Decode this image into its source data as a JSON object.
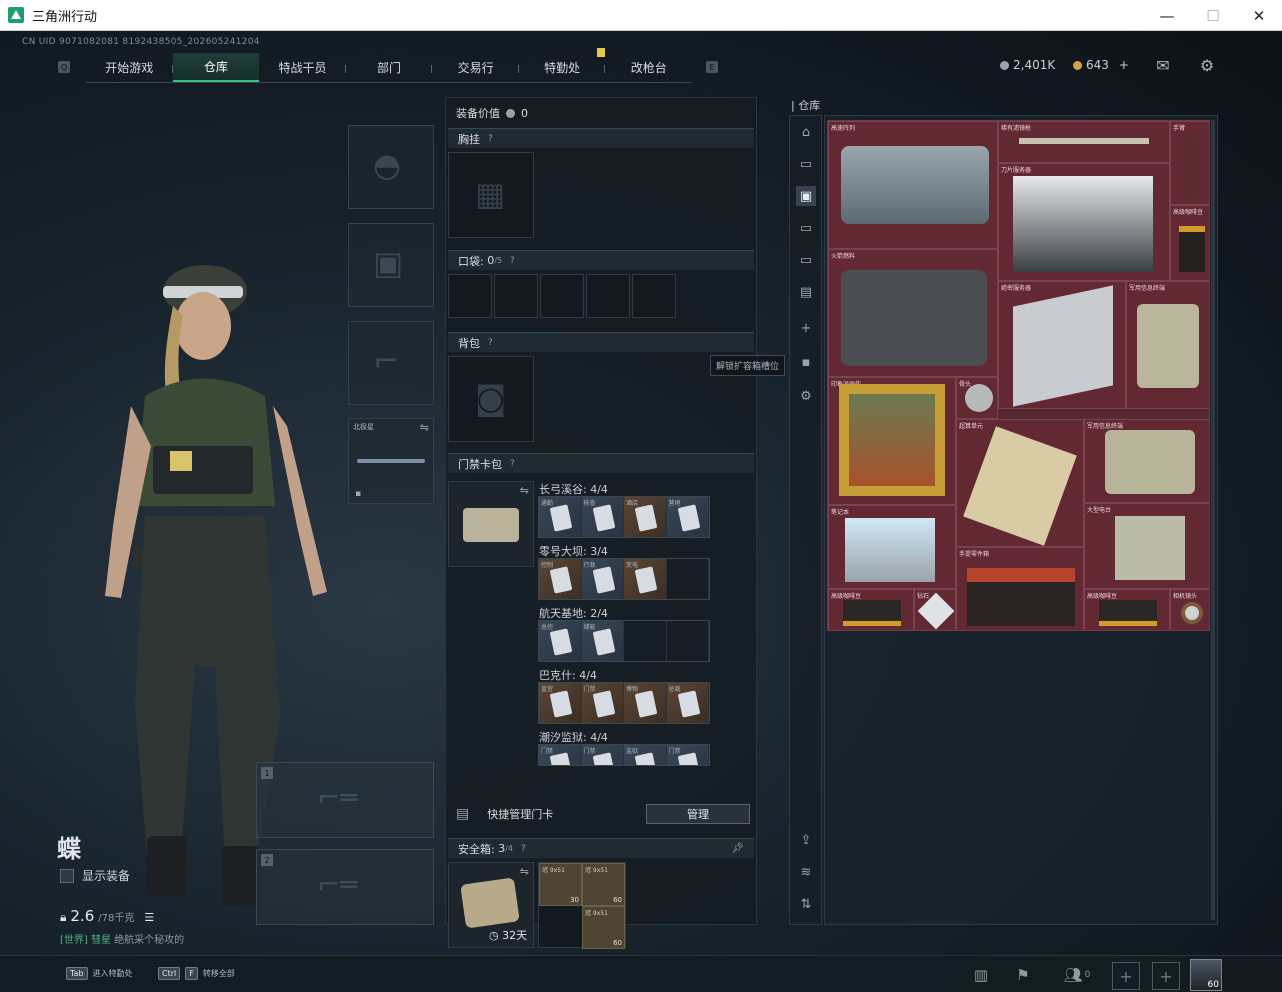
{
  "window": {
    "title": "三角洲行动",
    "min": "—",
    "max": "☐",
    "close": "✕"
  },
  "uid": "CN UID 9071082081 8192438505_202605241204",
  "nav": {
    "left_key": "Q",
    "right_key": "E",
    "tabs": [
      "开始游戏",
      "仓库",
      "特战干员",
      "部门",
      "交易行",
      "特勤处",
      "改枪台"
    ],
    "active": "仓库"
  },
  "currency": {
    "havoc": "2,401K",
    "coupon": "643",
    "add": "+"
  },
  "character": {
    "name": "蝶",
    "show_gear_label": "显示装备",
    "weight_value": "2.6",
    "weight_unit": "/78千克",
    "chat_channel": "[世界]",
    "chat_user": "彗星",
    "chat_text": "绝航采个秘攻的"
  },
  "equipment": {
    "melee_label": "北极星",
    "weapon_slot_1": "1",
    "weapon_slot_2": "2"
  },
  "middle": {
    "equip_value_label": "装备价值",
    "equip_value": "0",
    "chest_rig": "胸挂",
    "pockets_label": "口袋:",
    "pockets_count": "0",
    "pockets_max": "/5",
    "backpack": "背包",
    "keycard_pack": "门禁卡包",
    "unlock_hint": "解锁扩容箱槽位",
    "maps": [
      {
        "name": "长弓溪谷: 4/4",
        "cards": [
          "通勤",
          "核查",
          "酒店",
          "营地"
        ]
      },
      {
        "name": "零号大坝: 3/4",
        "cards": [
          "控制",
          "行政",
          "变电"
        ]
      },
      {
        "name": "航天基地: 2/4",
        "cards": [
          "总控",
          "储能"
        ]
      },
      {
        "name": "巴克什: 4/4",
        "cards": [
          "皇宫",
          "门禁",
          "博物",
          "总裁"
        ]
      },
      {
        "name": "潮汐监狱: 4/4",
        "cards": [
          "门禁",
          "门禁",
          "监狱",
          "门禁"
        ]
      }
    ],
    "quick_manage": "快捷管理门卡",
    "manage_btn": "管理",
    "safe_box_label": "安全箱:",
    "safe_box_count": "3",
    "safe_box_max": "/4",
    "safe_box_days": "32天",
    "ammo": [
      {
        "name": "冠 9x51",
        "count": "30"
      },
      {
        "name": "冠 9x51",
        "count": "60"
      },
      {
        "name": "冠 9x51",
        "count": "60"
      }
    ]
  },
  "storage": {
    "title": "仓库",
    "items": [
      {
        "label": "高速阵列",
        "icon": "server-array"
      },
      {
        "label": "稀有滤镜枪",
        "icon": "rifle"
      },
      {
        "label": "手臂",
        "icon": "arm"
      },
      {
        "label": "刀片服务器",
        "icon": "blade-server"
      },
      {
        "label": "高级咖啡豆",
        "icon": "coffee"
      },
      {
        "label": "火箭燃料",
        "icon": "fuel-can"
      },
      {
        "label": "绝密服务器",
        "icon": "motherboard"
      },
      {
        "label": "军用信息终端",
        "icon": "terminal"
      },
      {
        "label": "印象派画作",
        "icon": "painting"
      },
      {
        "label": "骨头",
        "icon": "medal"
      },
      {
        "label": "超算单元",
        "icon": "cpu-unit"
      },
      {
        "label": "军用信息终端",
        "icon": "terminal"
      },
      {
        "label": "笔记本",
        "icon": "laptop"
      },
      {
        "label": "大型电台",
        "icon": "radio"
      },
      {
        "label": "手提零件箱",
        "icon": "parts-box"
      },
      {
        "label": "高级咖啡豆",
        "icon": "coffee"
      },
      {
        "label": "钻石",
        "icon": "diamond"
      },
      {
        "label": "高级咖啡豆",
        "icon": "coffee"
      },
      {
        "label": "相机镜头",
        "icon": "lens"
      }
    ]
  },
  "bottom": {
    "tab_key": "Tab",
    "tab_hint": "进入特勤处",
    "ctrl_key": "Ctrl",
    "f_key": "F",
    "ctrl_hint": "转移全部",
    "friends_count": "0",
    "level": "60"
  },
  "colors": {
    "accent": "#35c28d",
    "storage_bg": "#572a32",
    "panel": "#1f2a31"
  }
}
